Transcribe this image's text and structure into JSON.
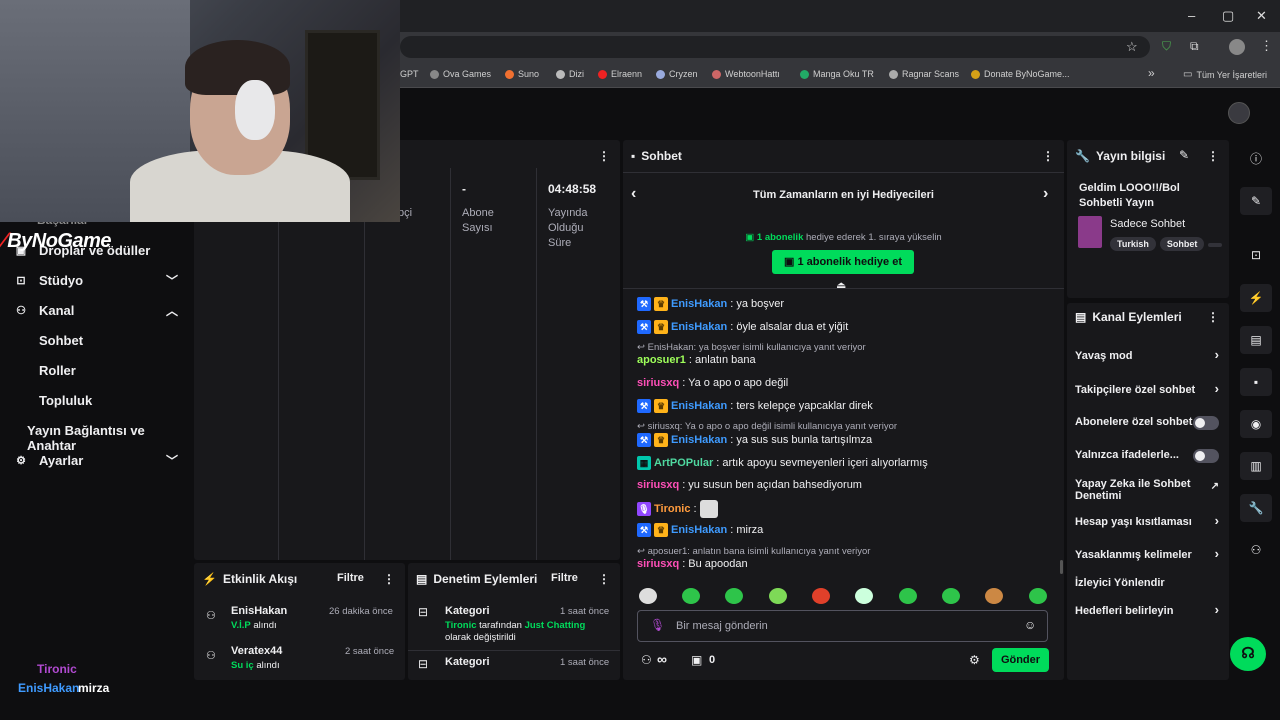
{
  "browser": {
    "bookmarks": [
      "GPT",
      "Ova Games",
      "Suno",
      "Dizi",
      "Elraenn",
      "Cryzen",
      "WebtoonHattı",
      "Manga Oku TR",
      "Ragnar Scans",
      "Donate ByNoGame...",
      "Tüm Yer İşaretleri"
    ],
    "more_label": "»"
  },
  "logo": {
    "text": "ByNoGame"
  },
  "nav": {
    "partial_items": [
      "Başarılar",
      "Droplar ve ödüller"
    ],
    "studio": "Stüdyo",
    "channel": "Kanal",
    "chat": "Sohbet",
    "roles": "Roller",
    "community": "Topluluk",
    "stream_link": "Yayın Bağlantısı ve Anahtar",
    "settings": "Ayarlar"
  },
  "stats": {
    "partial_label": "pçi",
    "sub_value": "-",
    "sub_label_1": "Abone",
    "sub_label_2": "Sayısı",
    "time_value": "04:48:58",
    "time_label_1": "Yayında",
    "time_label_2": "Olduğu",
    "time_label_3": "Süre"
  },
  "activity": {
    "title": "Etkinlik Akışı",
    "filter": "Filtre",
    "items": [
      {
        "user": "EnisHakan",
        "time": "26 dakika önce",
        "tag": "V.İ.P",
        "suffix": " alındı"
      },
      {
        "user": "Veratex44",
        "time": "2 saat önce",
        "tag": "Su iç",
        "suffix": " alındı"
      }
    ]
  },
  "moderation": {
    "title": "Denetim Eylemleri",
    "filter": "Filtre",
    "items": [
      {
        "label": "Kategori",
        "time": "1 saat önce",
        "by": "Tironic",
        "mid": " tarafından ",
        "value": "Just Chatting",
        "tail": "olarak değiştirildi"
      },
      {
        "label": "Kategori",
        "time": "1 saat önce"
      }
    ]
  },
  "chat": {
    "title": "Sohbet",
    "leaderboard_title": "Tüm Zamanların en iyi Hediyecileri",
    "gift_hint_link": "1 abonelik",
    "gift_hint_rest": " hediye ederek 1. sıraya yükselin",
    "gift_button": "1 abonelik hediye et",
    "messages": [
      {
        "user": "EnisHakan",
        "text": ": ya boşver"
      },
      {
        "user": "EnisHakan",
        "text": ": öyle alsalar dua et yiğit"
      },
      {
        "reply": "EnisHakan: ya boşver isimli kullanıcıya yanıt veriyor"
      },
      {
        "user": "aposuer1",
        "text": ": anlatın bana"
      },
      {
        "user": "siriusxq",
        "text": ": Ya o apo o apo değil"
      },
      {
        "user": "EnisHakan",
        "text": ": ters kelepçe yapcaklar direk"
      },
      {
        "reply": "siriusxq: Ya o apo o apo değil isimli kullanıcıya yanıt veriyor"
      },
      {
        "user": "EnisHakan",
        "text": ": ya sus sus bunla tartışılmza"
      },
      {
        "user": "ArtPOPular",
        "text": ": artık apoyu sevmeyenleri içeri alıyorlarmış"
      },
      {
        "user": "siriusxq",
        "text": ": yu susun ben açıdan bahsediyorum"
      },
      {
        "user": "Tironic",
        "text": ":"
      },
      {
        "user": "EnisHakan",
        "text": ": mirza"
      },
      {
        "reply": "aposuer1: anlatın bana isimli kullanıcıya yanıt veriyor"
      },
      {
        "user": "siriusxq",
        "text": ": Bu apoodan"
      }
    ],
    "input_placeholder": "Bir mesaj gönderin",
    "viewers": "∞",
    "points": "0",
    "send": "Gönder"
  },
  "stream_info": {
    "title": "Yayın bilgisi",
    "stream_title": "Geldim LOOO!!/Bol Sohbetli Yayın",
    "category": "Sadece Sohbet",
    "tags": [
      "Turkish",
      "Sohbet"
    ]
  },
  "channel_actions": {
    "title": "Kanal Eylemleri",
    "slow_mode": "Yavaş mod",
    "followers_only": "Takipçilere özel sohbet",
    "subs_only": "Abonelere özel sohbet",
    "emotes_only": "Yalnızca ifadelerle...",
    "ai_mod_1": "Yapay Zeka ile Sohbet",
    "ai_mod_2": "Denetimi",
    "age_restrict": "Hesap yaşı kısıtlaması",
    "banned_words": "Yasaklanmış kelimeler",
    "raid": "İzleyici Yönlendir",
    "goals": "Hedefleri belirleyin"
  },
  "overlay": {
    "name1": "Tironic",
    "name2": "EnisHakan",
    "msg2": "mirza"
  },
  "colors": {
    "accent_green": "#00db5b",
    "enishakan": "#3f9bff",
    "aposuer": "#9eff5a",
    "sirius": "#ff4fb8",
    "artpop": "#4fd8a0",
    "tironic": "#ff9b3d"
  }
}
